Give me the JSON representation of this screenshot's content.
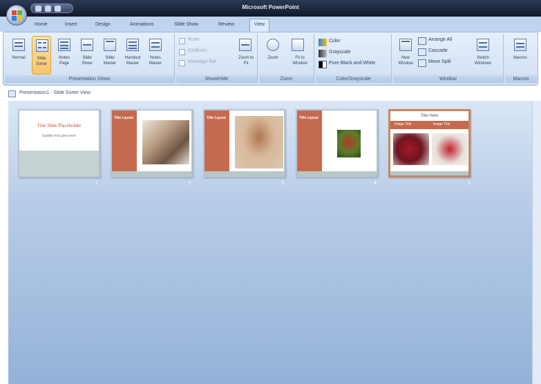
{
  "app": {
    "title": "Microsoft PowerPoint"
  },
  "tabs": [
    {
      "label": "Home"
    },
    {
      "label": "Insert"
    },
    {
      "label": "Design"
    },
    {
      "label": "Animations"
    },
    {
      "label": "Slide Show"
    },
    {
      "label": "Review"
    },
    {
      "label": "View",
      "active": true
    }
  ],
  "ribbon": {
    "presentation_views": {
      "label": "Presentation Views",
      "buttons": [
        {
          "label": "Normal"
        },
        {
          "label": "Slide Sorter",
          "selected": true
        },
        {
          "label": "Notes Page"
        },
        {
          "label": "Slide Show"
        },
        {
          "label": "Slide Master"
        },
        {
          "label": "Handout Master"
        },
        {
          "label": "Notes Master"
        }
      ]
    },
    "show_hide": {
      "label": "Show/Hide",
      "checks": [
        {
          "label": "Ruler"
        },
        {
          "label": "Gridlines"
        },
        {
          "label": "Message Bar"
        }
      ],
      "button": {
        "label": "Zoom to Fit"
      }
    },
    "zoom": {
      "label": "Zoom",
      "buttons": [
        {
          "label": "Zoom"
        },
        {
          "label": "Fit to Window"
        }
      ]
    },
    "color_grayscale": {
      "label": "Color/Grayscale",
      "items": [
        {
          "label": "Color"
        },
        {
          "label": "Grayscale"
        },
        {
          "label": "Pure Black and White"
        }
      ]
    },
    "window": {
      "label": "Window",
      "big": [
        {
          "label": "New Window"
        },
        {
          "label": "Switch Windows"
        }
      ],
      "small": [
        {
          "label": "Arrange All"
        },
        {
          "label": "Cascade"
        },
        {
          "label": "Move Split"
        }
      ]
    },
    "macros": {
      "label": "Macros",
      "button": {
        "label": "Macros"
      }
    }
  },
  "breadcrumb": {
    "text": "Presentation1 - Slide Sorter View"
  },
  "slides": [
    {
      "number": "1",
      "title": "Title Slide Placeholder",
      "subtitle": "Subtitle text goes here"
    },
    {
      "number": "2",
      "title": "Title Layout"
    },
    {
      "number": "3",
      "title": "Title Layout"
    },
    {
      "number": "4",
      "title": "Title Layout"
    },
    {
      "number": "5",
      "title": "Title Here",
      "left": "Image Title",
      "right": "Image Title",
      "selected": true
    }
  ],
  "colors": {
    "accent": "#c66a4f",
    "ribbon": "#dbe7f6",
    "slide_area_top": "#d9e6f5",
    "slide_area_bottom": "#94b2d8",
    "title_bar": "#1d2840",
    "selected_border": "#c9865d"
  }
}
